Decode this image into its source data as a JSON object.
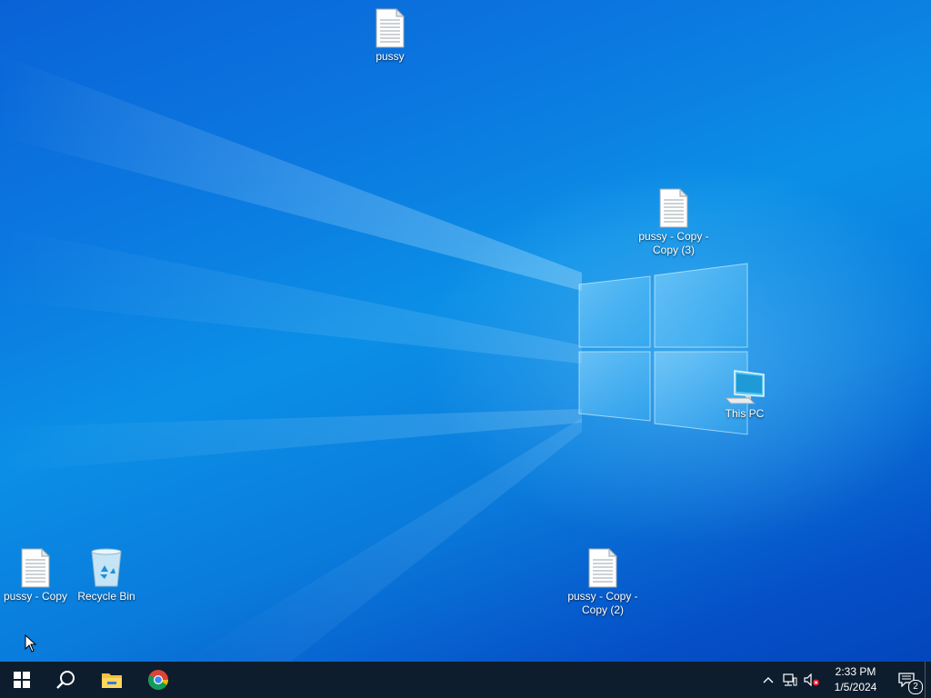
{
  "desktop": {
    "icons": [
      {
        "label": "pussy",
        "type": "text-file-icon"
      },
      {
        "label": "pussy - Copy - Copy (3)",
        "type": "text-file-icon"
      },
      {
        "label": "This PC",
        "type": "this-pc-icon"
      },
      {
        "label": "pussy - Copy",
        "type": "text-file-icon"
      },
      {
        "label": "Recycle Bin",
        "type": "recycle-bin-icon"
      },
      {
        "label": "pussy - Copy - Copy (2)",
        "type": "text-file-icon"
      }
    ]
  },
  "taskbar": {
    "buttons": [
      {
        "icon": "windows-start-icon"
      },
      {
        "icon": "search-icon"
      },
      {
        "icon": "file-explorer-icon"
      },
      {
        "icon": "chrome-icon"
      }
    ],
    "tray": {
      "icons": [
        "chevron-up-icon",
        "network-icon",
        "volume-muted-icon"
      ],
      "time": "2:33 PM",
      "date": "1/5/2024",
      "notification_count": "2"
    }
  },
  "colors": {
    "taskbar": "#0d1d2d",
    "wallpaper_blue": "#0b78e0"
  }
}
